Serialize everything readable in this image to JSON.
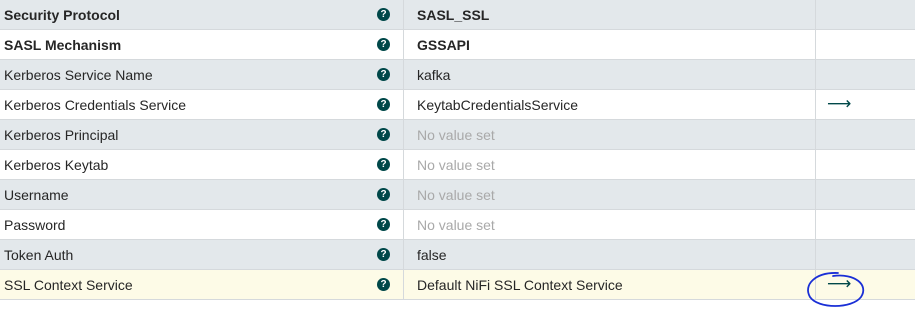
{
  "properties": [
    {
      "name": "Security Protocol",
      "value": "SASL_SSL",
      "name_bold": true,
      "value_bold": true,
      "unset": false,
      "link": false
    },
    {
      "name": "SASL Mechanism",
      "value": "GSSAPI",
      "name_bold": true,
      "value_bold": true,
      "unset": false,
      "link": false
    },
    {
      "name": "Kerberos Service Name",
      "value": "kafka",
      "name_bold": false,
      "value_bold": false,
      "unset": false,
      "link": false
    },
    {
      "name": "Kerberos Credentials Service",
      "value": "KeytabCredentialsService",
      "name_bold": false,
      "value_bold": false,
      "unset": false,
      "link": true
    },
    {
      "name": "Kerberos Principal",
      "value": "No value set",
      "name_bold": false,
      "value_bold": false,
      "unset": true,
      "link": false
    },
    {
      "name": "Kerberos Keytab",
      "value": "No value set",
      "name_bold": false,
      "value_bold": false,
      "unset": true,
      "link": false
    },
    {
      "name": "Username",
      "value": "No value set",
      "name_bold": false,
      "value_bold": false,
      "unset": true,
      "link": false
    },
    {
      "name": "Password",
      "value": "No value set",
      "name_bold": false,
      "value_bold": false,
      "unset": true,
      "link": false
    },
    {
      "name": "Token Auth",
      "value": "false",
      "name_bold": false,
      "value_bold": false,
      "unset": false,
      "link": false
    },
    {
      "name": "SSL Context Service",
      "value": "Default NiFi SSL Context Service",
      "name_bold": false,
      "value_bold": false,
      "unset": false,
      "link": true,
      "highlighted": true
    }
  ],
  "icons": {
    "help": "?",
    "goto": "⟶"
  },
  "colors": {
    "accent": "#004849",
    "annotation": "#1a2fd6",
    "highlight_row": "#fdfbe7",
    "alt_row": "#e3e8eb"
  }
}
